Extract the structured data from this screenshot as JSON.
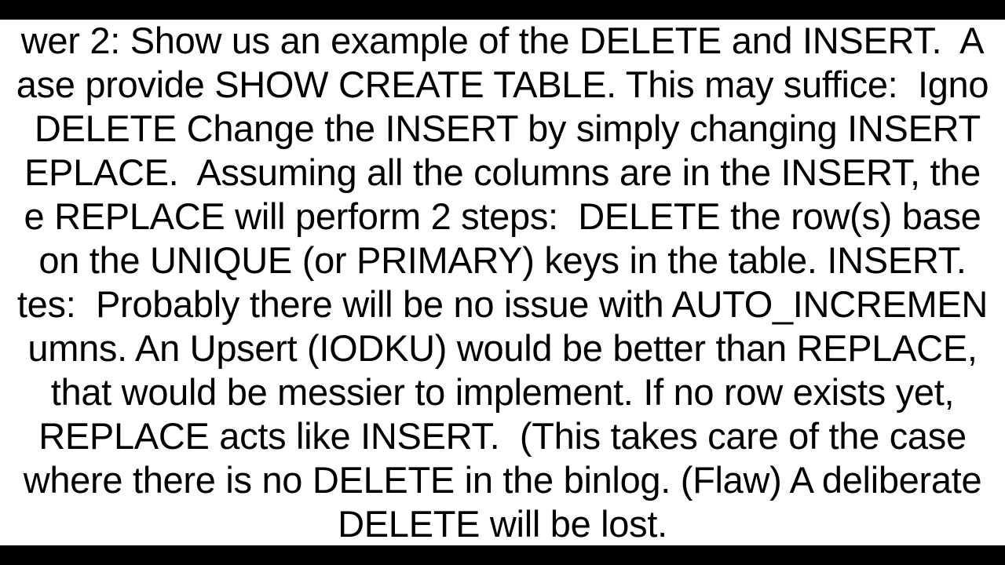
{
  "document": {
    "body_text": "wer 2: Show us an example of the DELETE and INSERT.  A\nase provide SHOW CREATE TABLE. This may suffice:  Igno\n DELETE Change the INSERT by simply changing INSERT\nEPLACE.  Assuming all the columns are in the INSERT, the\ne REPLACE will perform 2 steps:  DELETE the row(s) base\non the UNIQUE (or PRIMARY) keys in the table. INSERT.\ntes:  Probably there will be no issue with AUTO_INCREMEN\numns. An Upsert (IODKU) would be better than REPLACE,\nthat would be messier to implement. If no row exists yet,\nREPLACE acts like INSERT.  (This takes care of the case\nwhere there is no DELETE in the binlog. (Flaw) A deliberate\nDELETE will be lost."
  }
}
